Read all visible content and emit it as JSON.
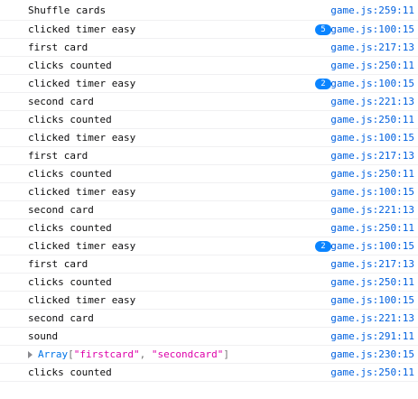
{
  "console": {
    "rows": [
      {
        "message": "Shuffle cards",
        "count": null,
        "location": "game.js:259:11"
      },
      {
        "message": "clicked timer easy",
        "count": "5",
        "location": "game.js:100:15"
      },
      {
        "message": "first card",
        "count": null,
        "location": "game.js:217:13"
      },
      {
        "message": "clicks counted",
        "count": null,
        "location": "game.js:250:11"
      },
      {
        "message": "clicked timer easy",
        "count": "2",
        "location": "game.js:100:15"
      },
      {
        "message": "second card",
        "count": null,
        "location": "game.js:221:13"
      },
      {
        "message": "clicks counted",
        "count": null,
        "location": "game.js:250:11"
      },
      {
        "message": "clicked timer easy",
        "count": null,
        "location": "game.js:100:15"
      },
      {
        "message": "first card",
        "count": null,
        "location": "game.js:217:13"
      },
      {
        "message": "clicks counted",
        "count": null,
        "location": "game.js:250:11"
      },
      {
        "message": "clicked timer easy",
        "count": null,
        "location": "game.js:100:15"
      },
      {
        "message": "second card",
        "count": null,
        "location": "game.js:221:13"
      },
      {
        "message": "clicks counted",
        "count": null,
        "location": "game.js:250:11"
      },
      {
        "message": "clicked timer easy",
        "count": "2",
        "location": "game.js:100:15"
      },
      {
        "message": "first card",
        "count": null,
        "location": "game.js:217:13"
      },
      {
        "message": "clicks counted",
        "count": null,
        "location": "game.js:250:11"
      },
      {
        "message": "clicked timer easy",
        "count": null,
        "location": "game.js:100:15"
      },
      {
        "message": "second card",
        "count": null,
        "location": "game.js:221:13"
      },
      {
        "message": "sound",
        "count": null,
        "location": "game.js:291:11"
      },
      {
        "message": null,
        "count": null,
        "location": "game.js:230:15",
        "array": {
          "name": "Array",
          "open": "[",
          "items": [
            "\"firstcard\"",
            "\"secondcard\""
          ],
          "separator": ", ",
          "close": "]"
        }
      },
      {
        "message": "clicks counted",
        "count": null,
        "location": "game.js:250:11"
      }
    ]
  },
  "colors": {
    "link": "#0060df",
    "badge": "#0a84ff",
    "string": "#dd00a9",
    "object_name": "#0074e8"
  },
  "icons": {
    "expand": "triangle-right-icon"
  }
}
